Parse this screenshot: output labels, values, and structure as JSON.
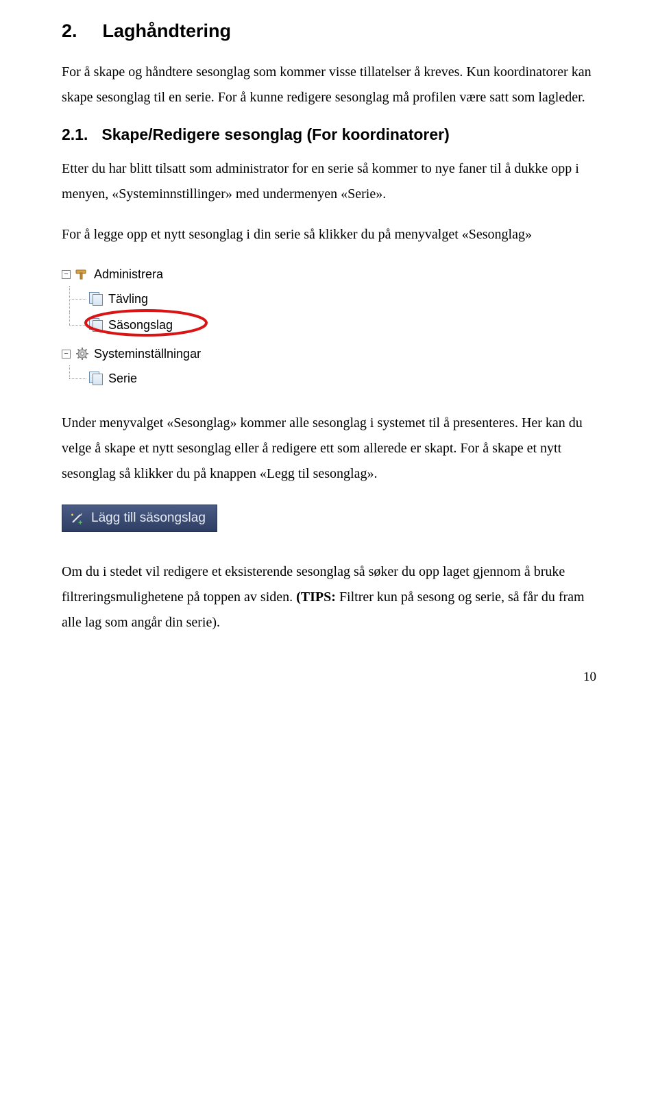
{
  "heading": {
    "number": "2.",
    "title": "Laghåndtering"
  },
  "intro": "For å skape og håndtere sesonglag som kommer visse tillatelser å kreves. Kun koordinatorer kan skape sesonglag til en serie. For å kunne redigere sesonglag må profilen være satt som lagleder.",
  "subheading": {
    "number": "2.1.",
    "title": "Skape/Redigere sesonglag (For koordinatorer)"
  },
  "sub_intro": "Etter du har blitt tilsatt som administrator for en serie så kommer to nye faner til å dukke opp i menyen, «Systeminnstillinger» med undermenyen «Serie».",
  "instruction_menu": "For å legge opp et nytt sesonglag i din serie så klikker du på menyvalget «Sesonglag»",
  "tree": {
    "root": {
      "label": "Administrera"
    },
    "items": [
      {
        "label": "Tävling"
      },
      {
        "label": "Säsongslag",
        "highlighted": true
      }
    ],
    "root2": {
      "label": "Systeminställningar"
    },
    "items2": [
      {
        "label": "Serie"
      }
    ]
  },
  "under_menu_text": "Under menyvalget «Sesonglag» kommer alle sesonglag i systemet til å presenteres. Her kan du velge å skape et nytt sesonglag eller å redigere ett som allerede er skapt. For å skape et nytt sesonglag så klikker du på knappen «Legg til sesonglag».",
  "button_label": "Lägg till säsongslag",
  "edit_text_pre": "Om du i stedet vil redigere et eksisterende sesonglag så søker du opp laget gjennom å bruke filtreringsmulighetene på toppen av siden. ",
  "edit_text_bold": "(TIPS:",
  "edit_text_post": " Filtrer kun på sesong og serie, så får du fram alle lag som angår din serie).",
  "page_number": "10"
}
